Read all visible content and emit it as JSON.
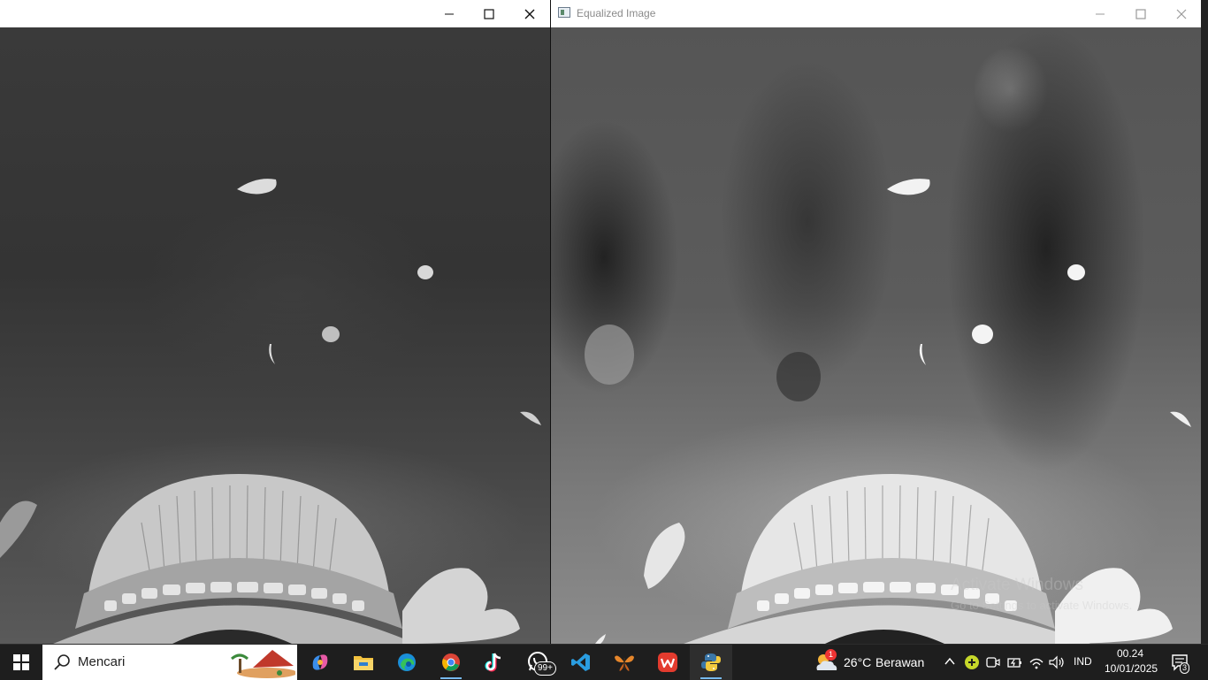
{
  "windows": {
    "left": {
      "title": ""
    },
    "right": {
      "title": "Equalized Image"
    }
  },
  "watermark": {
    "line1": "Activate Windows",
    "line2": "Go to Settings to activate Windows."
  },
  "taskbar": {
    "search_placeholder": "Mencari",
    "apps": [
      "copilot",
      "file-explorer",
      "edge",
      "chrome",
      "tiktok",
      "whatsapp",
      "vscode",
      "butterfly-app",
      "wps-office",
      "python"
    ],
    "whatsapp_badge": "99+",
    "weather": {
      "temp": "26°C",
      "condition": "Berawan",
      "alert_count": "1"
    },
    "language": "IND",
    "time": "00.24",
    "date": "10/01/2025",
    "notification_count": "3"
  },
  "colors": {
    "taskbar_bg": "#1e1e1e",
    "accent": "#76b9ed"
  }
}
